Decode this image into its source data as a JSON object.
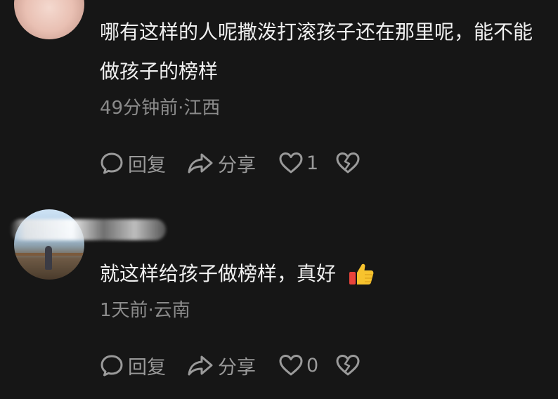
{
  "comments": [
    {
      "text": "哪有这样的人呢撒泼打滚孩子还在那里呢，能不能做孩子的榜样",
      "meta": "49分钟前·江西",
      "reply_label": "回复",
      "share_label": "分享",
      "like_count": "1"
    },
    {
      "text": "就这样给孩子做榜样，真好",
      "emoji": "👍",
      "meta": "1天前·云南",
      "reply_label": "回复",
      "share_label": "分享",
      "like_count": "0"
    }
  ],
  "colors": {
    "background": "#161616",
    "text": "#f0f0f0",
    "meta": "#8b8b8b",
    "action": "#9a9a9a"
  },
  "icons": [
    "comment-bubble-icon",
    "share-arrow-icon",
    "heart-icon",
    "broken-heart-icon",
    "thumbs-up-emoji"
  ]
}
